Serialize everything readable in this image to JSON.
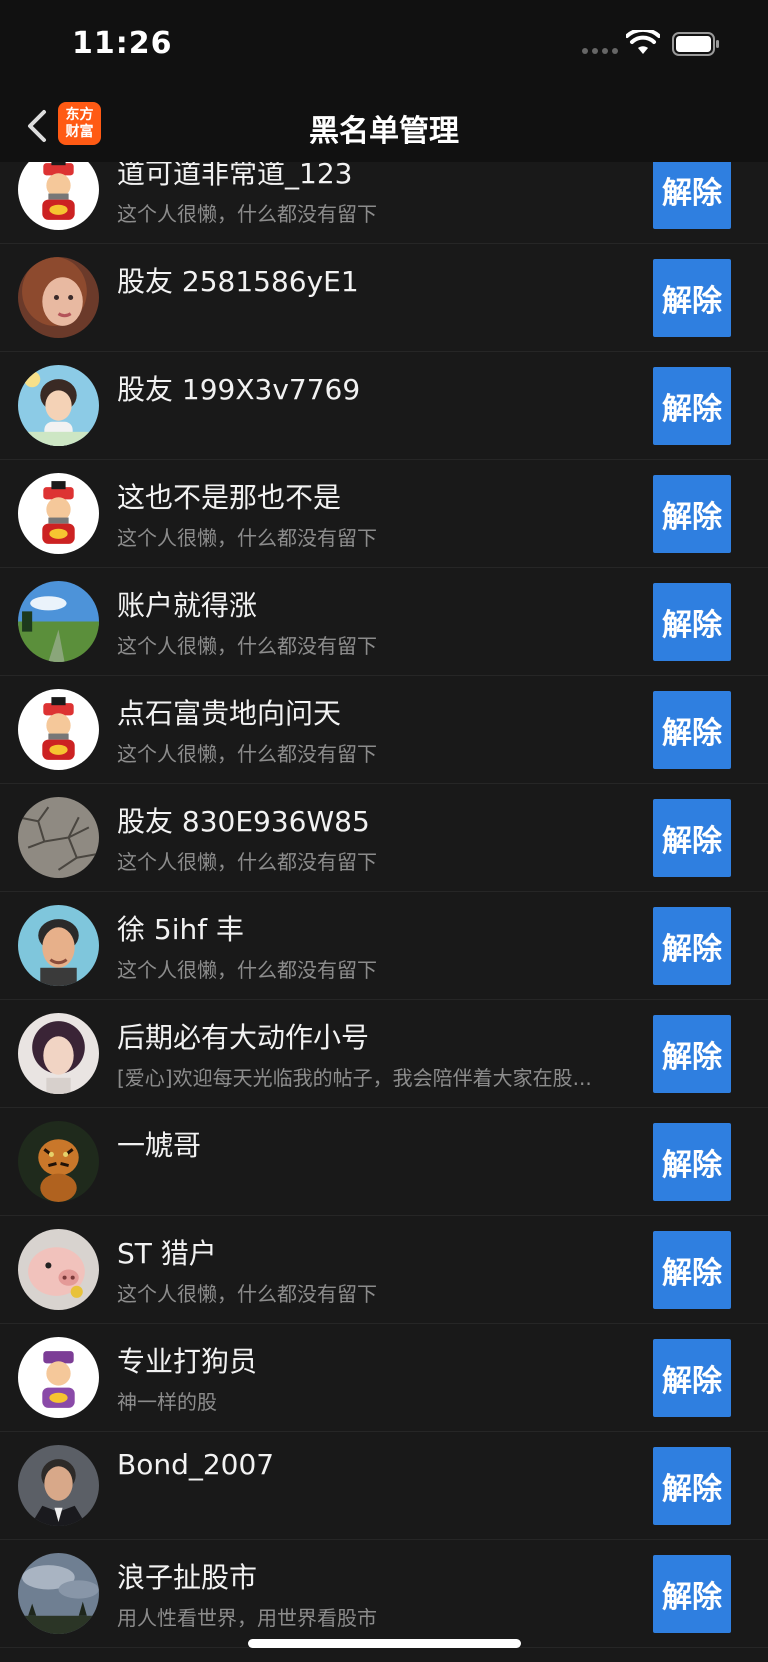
{
  "status": {
    "time": "11:26"
  },
  "nav": {
    "title": "黑名单管理",
    "logo_line1": "东方",
    "logo_line2": "财富"
  },
  "unblock_label": "解除",
  "users": [
    {
      "name": "道可道非常道_123",
      "bio": "这个人很懒，什么都没有留下",
      "avatar": "fortune-god-icon"
    },
    {
      "name": "股友 2581586yE1",
      "bio": "",
      "avatar": "woman-portrait"
    },
    {
      "name": "股友 199X3v7769",
      "bio": "",
      "avatar": "anime-boy"
    },
    {
      "name": "这也不是那也不是",
      "bio": "这个人很懒，什么都没有留下",
      "avatar": "fortune-god-icon"
    },
    {
      "name": "账户就得涨",
      "bio": "这个人很懒，什么都没有留下",
      "avatar": "landscape"
    },
    {
      "name": "点石富贵地向问天",
      "bio": "这个人很懒，什么都没有留下",
      "avatar": "fortune-god-icon"
    },
    {
      "name": "股友 830E936W85",
      "bio": "这个人很懒，什么都没有留下",
      "avatar": "cracked-earth"
    },
    {
      "name": "徐 5ihf 丰",
      "bio": "这个人很懒，什么都没有留下",
      "avatar": "man-cartoon"
    },
    {
      "name": "后期必有大动作小号",
      "bio": "[爱心]欢迎每天光临我的帖子，我会陪伴着大家在股...",
      "avatar": "man-long-hair"
    },
    {
      "name": "一虓哥",
      "bio": "",
      "avatar": "tiger"
    },
    {
      "name": "ST 猎户",
      "bio": "这个人很懒，什么都没有留下",
      "avatar": "pig"
    },
    {
      "name": "专业打狗员",
      "bio": "神一样的股",
      "avatar": "fortune-god-purple"
    },
    {
      "name": "Bond_2007",
      "bio": "",
      "avatar": "man-suit"
    },
    {
      "name": "浪子扯股市",
      "bio": "用人性看世界，用世界看股市",
      "avatar": "cloudy-sky"
    }
  ]
}
